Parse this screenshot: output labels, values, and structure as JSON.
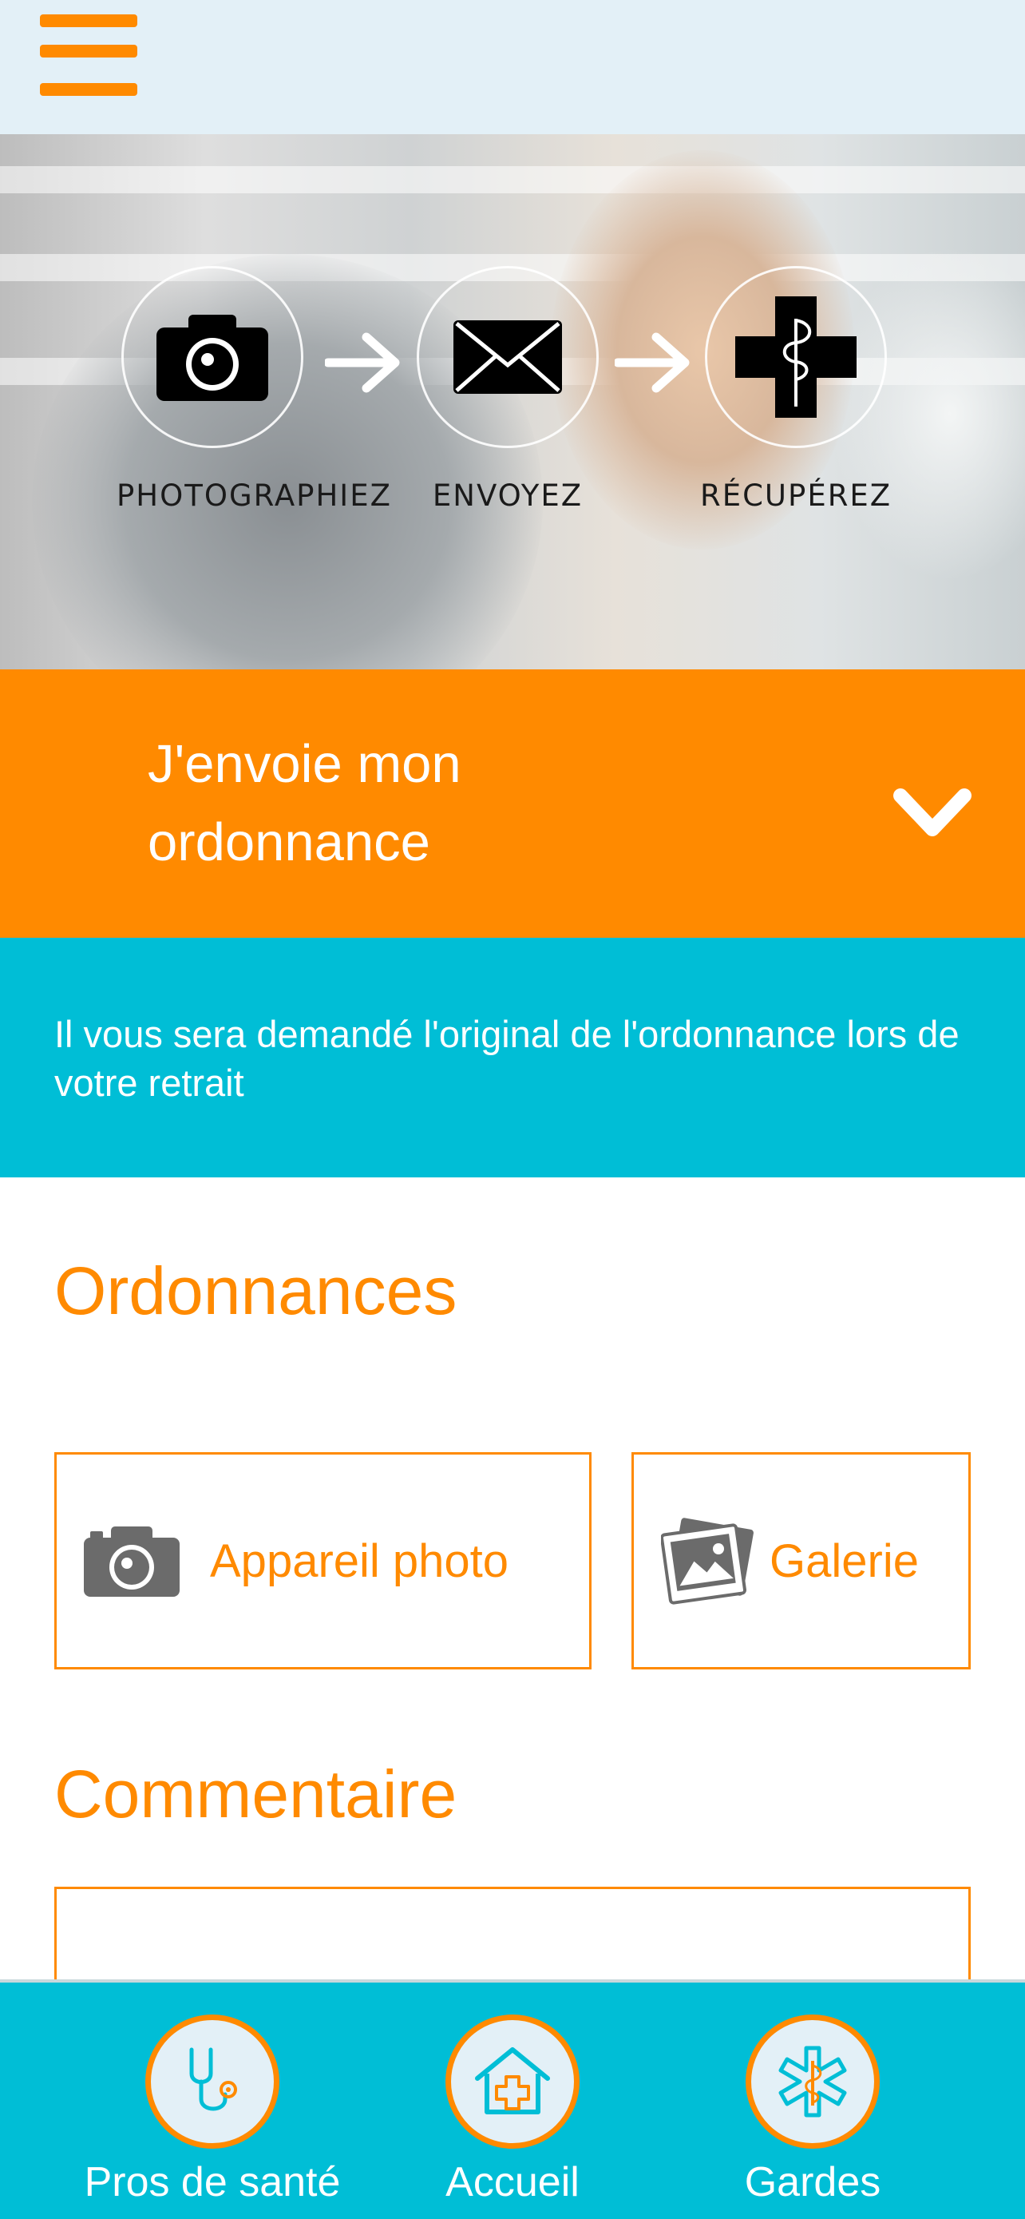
{
  "header": {
    "menu_icon": "hamburger-menu-icon"
  },
  "hero": {
    "steps": [
      {
        "label": "PHOTOGRAPHIEZ",
        "icon": "camera-icon"
      },
      {
        "label": "ENVOYEZ",
        "icon": "envelope-icon"
      },
      {
        "label": "RÉCUPÉREZ",
        "icon": "pharmacy-cross-icon"
      }
    ]
  },
  "send_section": {
    "title": "J'envoie mon ordonnance",
    "toggle_icon": "chevron-down-icon"
  },
  "notice": {
    "text": "Il vous sera demandé l'original de l'ordonnance lors de votre retrait"
  },
  "prescriptions": {
    "heading": "Ordonnances",
    "camera_button": "Appareil photo",
    "gallery_button": "Galerie"
  },
  "comment": {
    "heading": "Commentaire",
    "value": ""
  },
  "bottom_nav": {
    "items": [
      {
        "label": "Pros de santé",
        "icon": "stethoscope-icon"
      },
      {
        "label": "Accueil",
        "icon": "home-cross-icon"
      },
      {
        "label": "Gardes",
        "icon": "star-of-life-icon"
      }
    ]
  },
  "colors": {
    "accent": "#ff8a00",
    "teal": "#00bed6",
    "topbar_bg": "#e3f0f7"
  }
}
